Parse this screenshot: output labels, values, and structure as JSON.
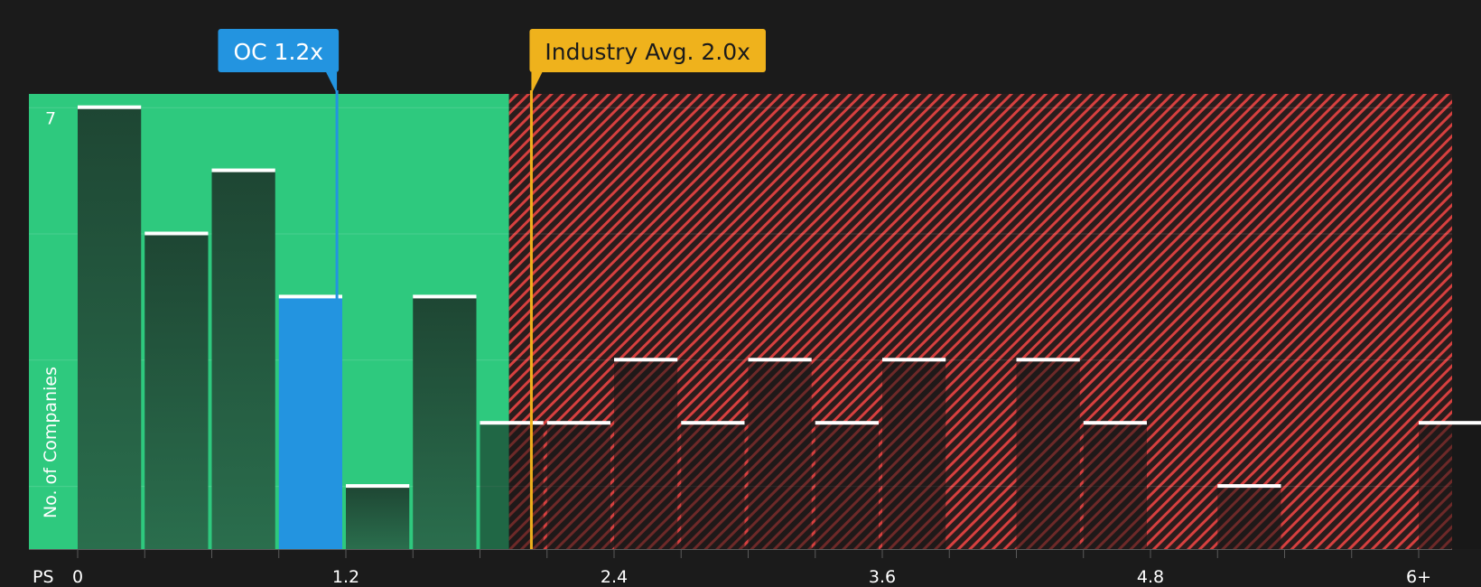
{
  "chart_data": {
    "type": "bar",
    "title": "",
    "xlabel": "PS",
    "ylabel": "No. of Companies",
    "x_ticks": [
      "0",
      "1.2",
      "2.4",
      "3.6",
      "4.8",
      "6+"
    ],
    "y_ticks": [
      "7"
    ],
    "xlim": [
      0,
      6.2
    ],
    "ylim": [
      0,
      7.25
    ],
    "bin_width": 0.3,
    "bins": [
      {
        "start": 0.0,
        "count": 7
      },
      {
        "start": 0.3,
        "count": 5
      },
      {
        "start": 0.6,
        "count": 6
      },
      {
        "start": 0.9,
        "count": 4,
        "highlight": true
      },
      {
        "start": 1.2,
        "count": 1
      },
      {
        "start": 1.5,
        "count": 4
      },
      {
        "start": 1.8,
        "count": 2
      },
      {
        "start": 2.1,
        "count": 2
      },
      {
        "start": 2.4,
        "count": 3
      },
      {
        "start": 2.7,
        "count": 2
      },
      {
        "start": 3.0,
        "count": 3
      },
      {
        "start": 3.3,
        "count": 2
      },
      {
        "start": 3.6,
        "count": 3
      },
      {
        "start": 3.9,
        "count": 0
      },
      {
        "start": 4.2,
        "count": 3
      },
      {
        "start": 4.5,
        "count": 2
      },
      {
        "start": 4.8,
        "count": 0
      },
      {
        "start": 5.1,
        "count": 1
      },
      {
        "start": 5.4,
        "count": 0
      },
      {
        "start": 5.7,
        "count": 0
      },
      {
        "start": 6.0,
        "count": 2
      }
    ],
    "markers": [
      {
        "id": "company",
        "label": "OC 1.2x",
        "value": 1.16,
        "color": "#2394e0",
        "text_color": "#ffffff"
      },
      {
        "id": "industry",
        "label": "Industry Avg. 2.0x",
        "value": 2.03,
        "color": "#efb21c",
        "text_color": "#1b1b1b"
      }
    ],
    "zones": {
      "undervalued_until": 1.93,
      "undervalued_color": "#2ec97e",
      "overvalued_color": "#d7403f"
    },
    "colors": {
      "background": "#1b1b1b",
      "bar_dark": "#1e4a35",
      "bar_highlight": "#2394e0",
      "bar_top": "#ffffff"
    },
    "grid": true
  }
}
